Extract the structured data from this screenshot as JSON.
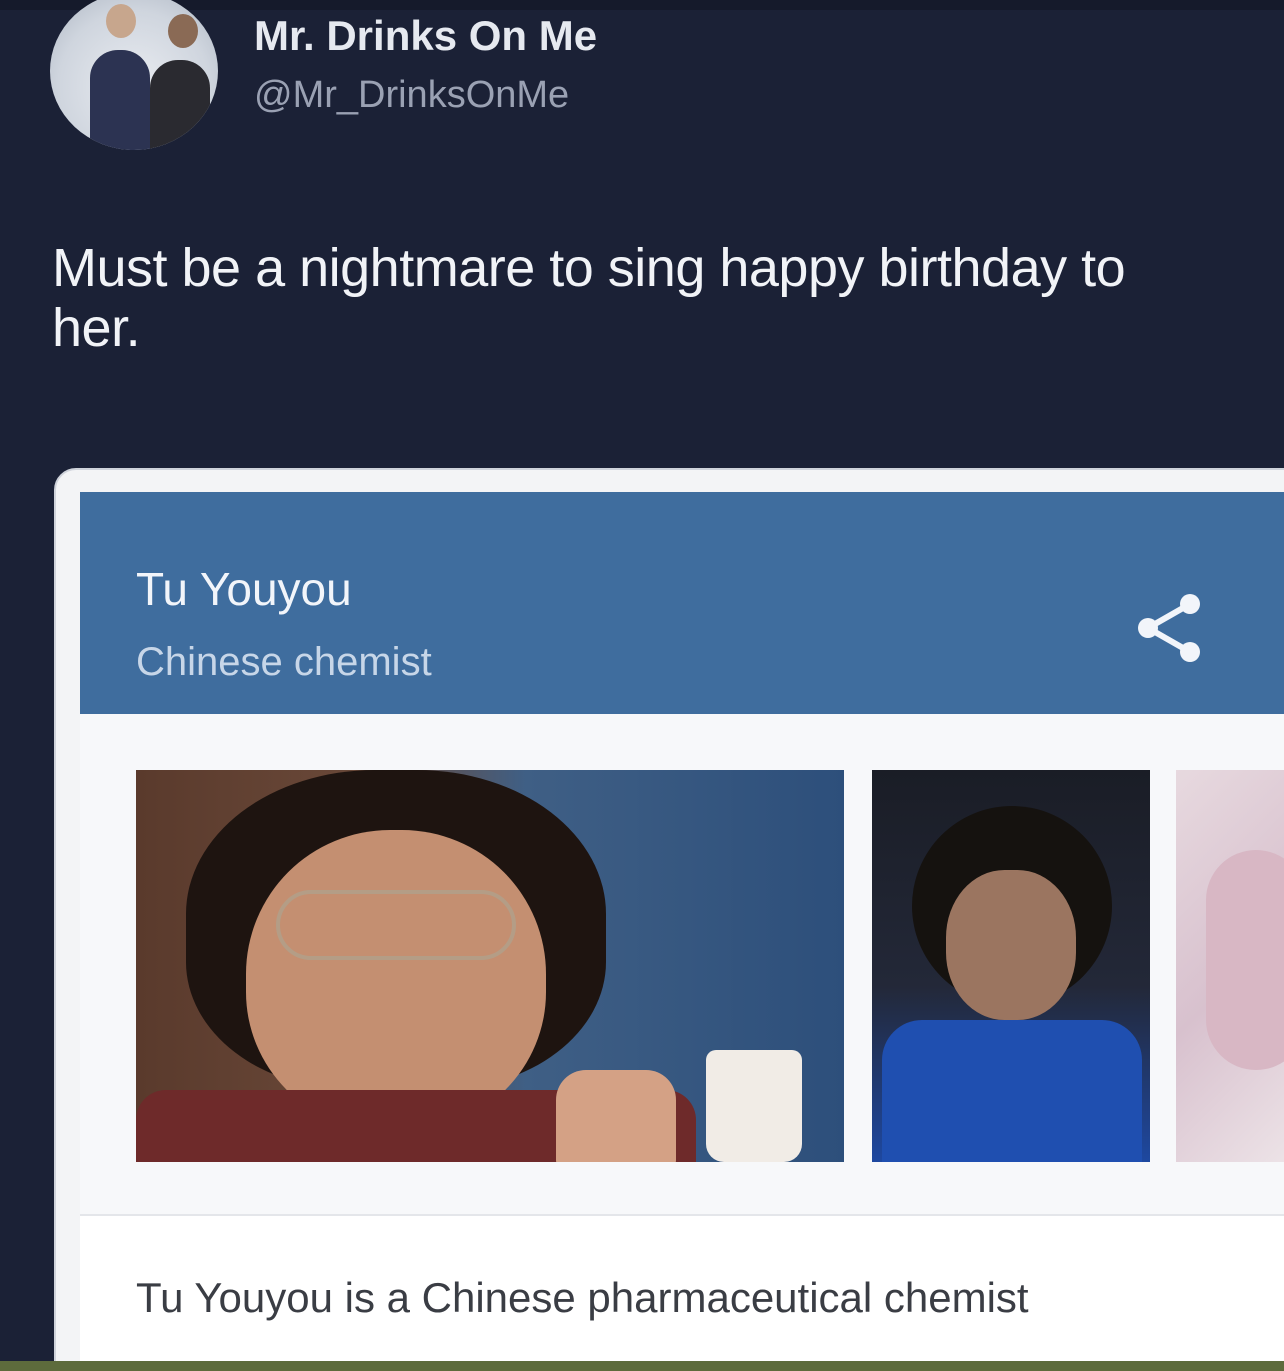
{
  "tweet": {
    "display_name": "Mr. Drinks On Me",
    "handle": "@Mr_DrinksOnMe",
    "text": "Must be a nightmare to sing happy birthday to her."
  },
  "knowledge_panel": {
    "title": "Tu Youyou",
    "subtitle": "Chinese chemist",
    "share_icon": "share-icon",
    "description": "Tu Youyou is a Chinese pharmaceutical chemist"
  },
  "colors": {
    "background": "#1b2136",
    "panel_header": "#3f6d9e",
    "card": "#f3f4f6"
  }
}
